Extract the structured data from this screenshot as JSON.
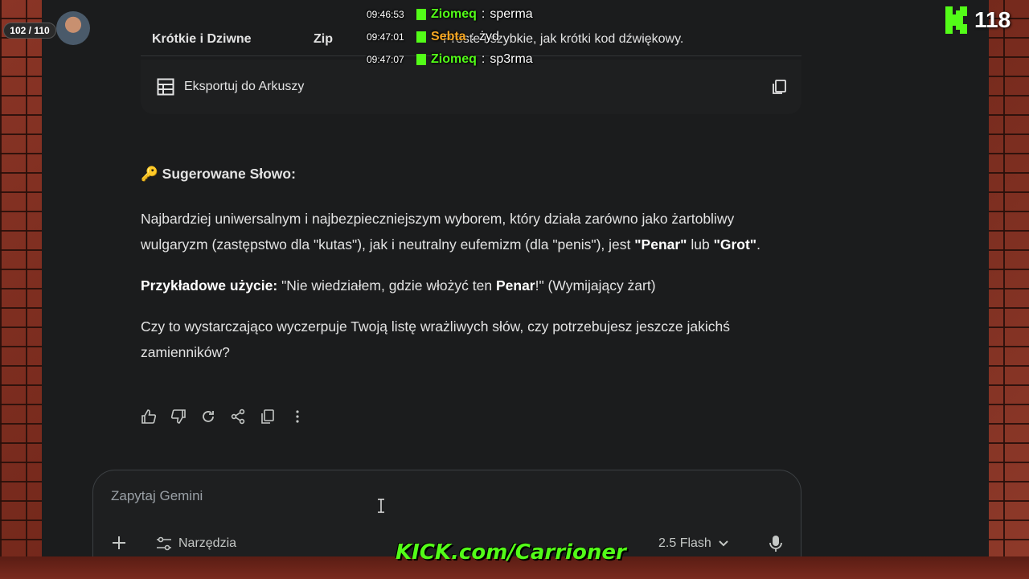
{
  "table": {
    "row": {
      "col1": "Krótkie i Dziwne",
      "col2": "Zip",
      "col3": "Proste i szybkie, jak krótki kod dźwiękowy."
    },
    "export_label": "Eksportuj do Arkuszy"
  },
  "response": {
    "heading_emoji": "🔑",
    "heading": "Sugerowane Słowo:",
    "p1_text": "Najbardziej uniwersalnym i najbezpieczniejszym wyborem, który działa zarówno jako żartobliwy wulgaryzm (zastępstwo dla \"kutas\"), jak i neutralny eufemizm (dla \"penis\"), jest ",
    "p1_b1": "\"Penar\"",
    "p1_mid": " lub ",
    "p1_b2": "\"Grot\"",
    "p1_end": ".",
    "p2_label": "Przykładowe użycie:",
    "p2_pre": " \"Nie wiedziałem, gdzie włożyć ten ",
    "p2_bold": "Penar",
    "p2_post": "!\" (Wymijający żart)",
    "p3": "Czy to wystarczająco wyczerpuje Twoją listę wrażliwych słów, czy potrzebujesz jeszcze jakichś zamienników?"
  },
  "actions": [
    "thumbs-up-icon",
    "thumbs-down-icon",
    "regenerate-icon",
    "share-icon",
    "copy-icon",
    "more-icon"
  ],
  "input": {
    "placeholder": "Zapytaj Gemini",
    "tools_label": "Narzędzia",
    "model_label": "2.5 Flash"
  },
  "overlay": {
    "viewer_pill": "102 / 110",
    "kick_count": "118",
    "kick_url": "KICK.com/Carrioner",
    "chat": [
      {
        "time": "09:46:53",
        "user": "Ziomeq",
        "sep": ":",
        "msg": "sperma",
        "color": "#53fc18"
      },
      {
        "time": "09:47:01",
        "user": "Sebta",
        "sep": ":",
        "msg": "żyd",
        "color": "#f5a623"
      },
      {
        "time": "09:47:07",
        "user": "Ziomeq",
        "sep": ":",
        "msg": "sp3rma",
        "color": "#53fc18"
      }
    ]
  },
  "colors": {
    "app_bg": "#1b1c1d",
    "kick_green": "#53fc18",
    "text": "#e3e3e3"
  }
}
